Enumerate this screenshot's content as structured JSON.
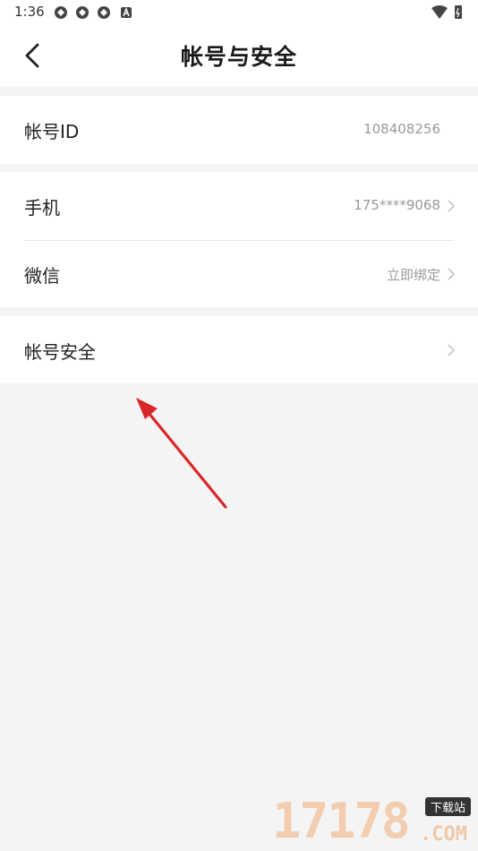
{
  "status_bar": {
    "time": "1:36"
  },
  "header": {
    "title": "帐号与安全"
  },
  "sections": {
    "account_id": {
      "label": "帐号ID",
      "value": "108408256"
    },
    "phone": {
      "label": "手机",
      "value": "175****9068"
    },
    "wechat": {
      "label": "微信",
      "value": "立即绑定"
    },
    "account_security": {
      "label": "帐号安全"
    }
  },
  "watermark": {
    "digits": "17178",
    "badge": "下载站",
    "suffix": ".COM"
  },
  "colors": {
    "background": "#f4f4f4",
    "card": "#ffffff",
    "annotation": "#d9262a"
  }
}
